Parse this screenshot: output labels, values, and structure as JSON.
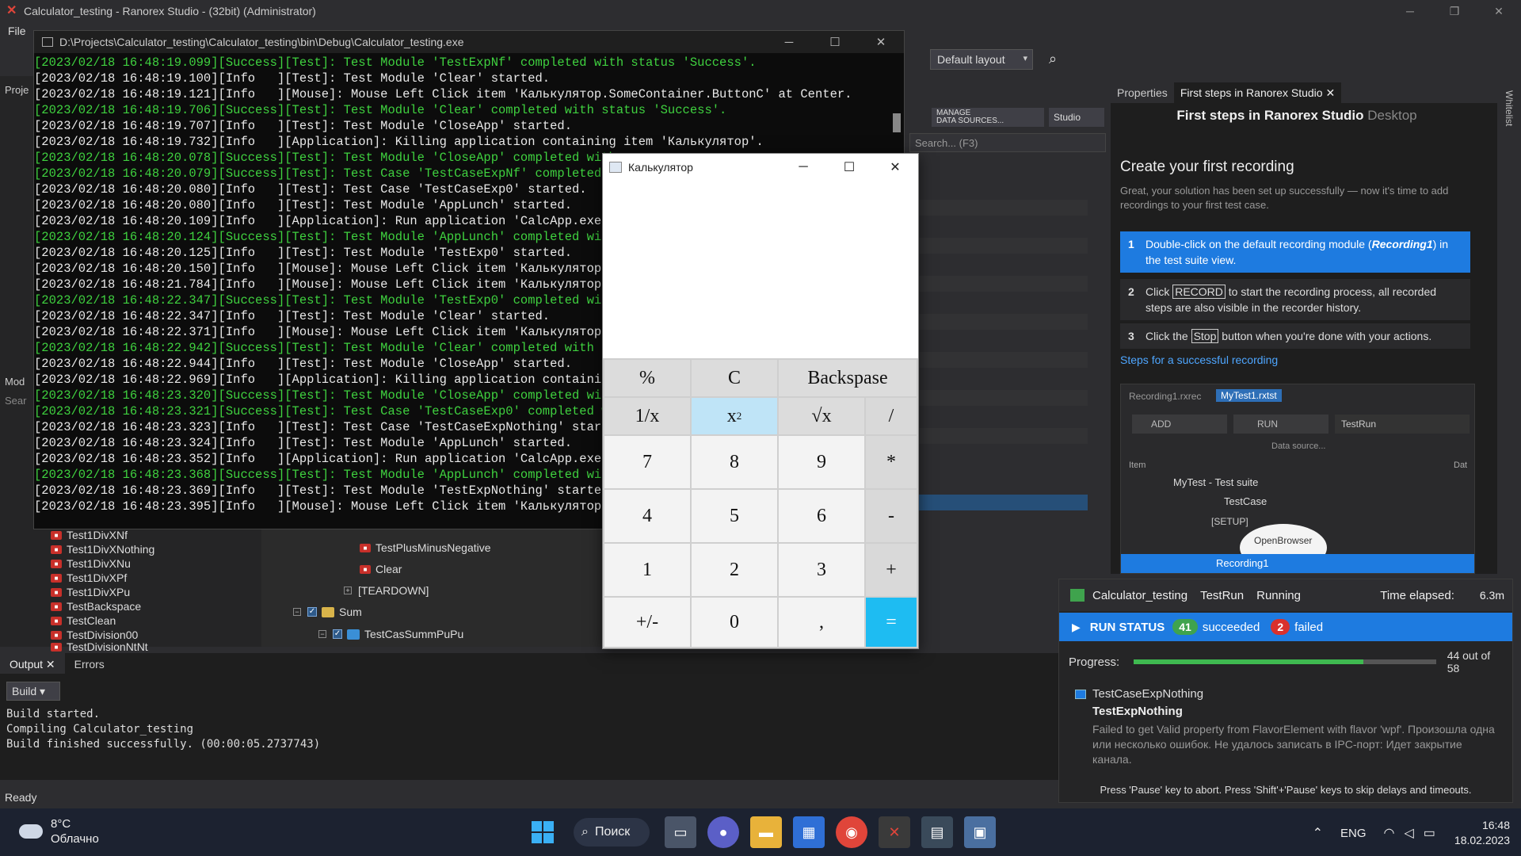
{
  "app": {
    "title": "Calculator_testing - Ranorex Studio - (32bit) (Administrator)",
    "menu_file": "File",
    "layout_select": "Default layout",
    "status": "Ready"
  },
  "center_toolbar": {
    "manage_ds_line1": "MANAGE",
    "manage_ds_line2": "DATA SOURCES...",
    "studio": "Studio",
    "search_placeholder": "Search... (F3)"
  },
  "left_panel": {
    "projects_tab": "Proje",
    "modules_tab": "Mod",
    "search": "Sear",
    "modules": [
      "Test1DivXNf",
      "Test1DivXNothing",
      "Test1DivXNu",
      "Test1DivXPf",
      "Test1DivXPu",
      "TestBackspace",
      "TestClean",
      "TestDivision00",
      "TestDivisionNtNt"
    ]
  },
  "tree": {
    "test_plus_minus_negative": "TestPlusMinusNegative",
    "clear": "Clear",
    "teardown": "[TEARDOWN]",
    "sum": "Sum",
    "test_case_summ": "TestCasSummPuPu"
  },
  "console": {
    "title": "D:\\Projects\\Calculator_testing\\Calculator_testing\\bin\\Debug\\Calculator_testing.exe",
    "lines": [
      {
        "type": "success",
        "text": "[2023/02/18 16:48:19.099][Success][Test]: Test Module 'TestExpNf' completed with status 'Success'."
      },
      {
        "type": "info",
        "text": "[2023/02/18 16:48:19.100][Info   ][Test]: Test Module 'Clear' started."
      },
      {
        "type": "info",
        "text": "[2023/02/18 16:48:19.121][Info   ][Mouse]: Mouse Left Click item 'Калькулятор.SomeContainer.ButtonC' at Center."
      },
      {
        "type": "success",
        "text": "[2023/02/18 16:48:19.706][Success][Test]: Test Module 'Clear' completed with status 'Success'."
      },
      {
        "type": "info",
        "text": "[2023/02/18 16:48:19.707][Info   ][Test]: Test Module 'CloseApp' started."
      },
      {
        "type": "info",
        "text": "[2023/02/18 16:48:19.732][Info   ][Application]: Killing application containing item 'Калькулятор'."
      },
      {
        "type": "success",
        "text": "[2023/02/18 16:48:20.078][Success][Test]: Test Module 'CloseApp' completed with"
      },
      {
        "type": "success",
        "text": "[2023/02/18 16:48:20.079][Success][Test]: Test Case 'TestCaseExpNf' completed wi"
      },
      {
        "type": "info",
        "text": "[2023/02/18 16:48:20.080][Info   ][Test]: Test Case 'TestCaseExp0' started."
      },
      {
        "type": "info",
        "text": "[2023/02/18 16:48:20.080][Info   ][Test]: Test Module 'AppLunch' started."
      },
      {
        "type": "info",
        "text": "[2023/02/18 16:48:20.109][Info   ][Application]: Run application 'CalcApp.exe' i"
      },
      {
        "type": "success",
        "text": "[2023/02/18 16:48:20.124][Success][Test]: Test Module 'AppLunch' completed with"
      },
      {
        "type": "info",
        "text": "[2023/02/18 16:48:20.125][Info   ][Test]: Test Module 'TestExp0' started."
      },
      {
        "type": "info",
        "text": "[2023/02/18 16:48:20.150][Info   ][Mouse]: Mouse Left Click item 'Калькулятор.So"
      },
      {
        "type": "info",
        "text": "[2023/02/18 16:48:21.784][Info   ][Mouse]: Mouse Left Click item 'Калькулятор.So"
      },
      {
        "type": "success",
        "text": "[2023/02/18 16:48:22.347][Success][Test]: Test Module 'TestExp0' completed with"
      },
      {
        "type": "info",
        "text": "[2023/02/18 16:48:22.347][Info   ][Test]: Test Module 'Clear' started."
      },
      {
        "type": "info",
        "text": "[2023/02/18 16:48:22.371][Info   ][Mouse]: Mouse Left Click item 'Калькулятор.So"
      },
      {
        "type": "success",
        "text": "[2023/02/18 16:48:22.942][Success][Test]: Test Module 'Clear' completed with st"
      },
      {
        "type": "info",
        "text": "[2023/02/18 16:48:22.944][Info   ][Test]: Test Module 'CloseApp' started."
      },
      {
        "type": "info",
        "text": "[2023/02/18 16:48:22.969][Info   ][Application]: Killing application containing"
      },
      {
        "type": "success",
        "text": "[2023/02/18 16:48:23.320][Success][Test]: Test Module 'CloseApp' completed with"
      },
      {
        "type": "success",
        "text": "[2023/02/18 16:48:23.321][Success][Test]: Test Case 'TestCaseExp0' completed wi"
      },
      {
        "type": "info",
        "text": "[2023/02/18 16:48:23.323][Info   ][Test]: Test Case 'TestCaseExpNothing' started"
      },
      {
        "type": "info",
        "text": "[2023/02/18 16:48:23.324][Info   ][Test]: Test Module 'AppLunch' started."
      },
      {
        "type": "info",
        "text": "[2023/02/18 16:48:23.352][Info   ][Application]: Run application 'CalcApp.exe' i"
      },
      {
        "type": "success",
        "text": "[2023/02/18 16:48:23.368][Success][Test]: Test Module 'AppLunch' completed with"
      },
      {
        "type": "info",
        "text": "[2023/02/18 16:48:23.369][Info   ][Test]: Test Module 'TestExpNothing' started."
      },
      {
        "type": "info",
        "text": "[2023/02/18 16:48:23.395][Info   ][Mouse]: Mouse Left Click item 'Калькулятор.So"
      }
    ]
  },
  "calculator": {
    "title": "Калькулятор",
    "display": "",
    "keys": {
      "percent": "%",
      "clear": "C",
      "backspace": "Backspase",
      "reciprocal": "1/x",
      "square": "x",
      "square_sup": "2",
      "sqrt": "√x",
      "divide": "/",
      "seven": "7",
      "eight": "8",
      "nine": "9",
      "multiply": "*",
      "four": "4",
      "five": "5",
      "six": "6",
      "minus": "-",
      "one": "1",
      "two": "2",
      "three": "3",
      "plus": "+",
      "negate": "+/-",
      "zero": "0",
      "comma": ",",
      "equals": "="
    }
  },
  "right_panel": {
    "tab_properties": "Properties",
    "tab_first_steps": "First steps in Ranorex Studio",
    "title": "First steps in Ranorex Studio",
    "title_sub": "Desktop",
    "heading": "Create your first recording",
    "intro": "Great, your solution has been set up successfully — now it's time to add recordings to your first test case.",
    "steps": [
      {
        "n": "1",
        "pre": "Double-click on the default recording module (",
        "em": "Recording1",
        "post": ") in the test suite view."
      },
      {
        "n": "2",
        "pre": "Click ",
        "kbd": "RECORD",
        "post": " to start the recording process, all recorded steps are also visible in the recorder history."
      },
      {
        "n": "3",
        "pre": "Click the ",
        "kbd": "Stop",
        "post": " button when you're done with your actions."
      }
    ],
    "link": "Steps for a successful recording",
    "preview": {
      "tab1": "Recording1.rxrec",
      "tab2": "MyTest1.rxtst",
      "add": "ADD",
      "run": "RUN",
      "testrun": "TestRun",
      "data_source": "Data source...",
      "col_item": "Item",
      "col_dat": "Dat",
      "suite": "MyTest - Test suite",
      "testcase": "TestCase",
      "setup": "[SETUP]",
      "open_browser": "OpenBrowser",
      "recording1": "Recording1"
    }
  },
  "run": {
    "solution": "Calculator_testing",
    "testrun": "TestRun",
    "state": "Running",
    "elapsed_label": "Time elapsed:",
    "elapsed_value": "6.3m",
    "status_label": "RUN STATUS",
    "succeeded_count": "41",
    "succeeded_label": "succeeded",
    "failed_count": "2",
    "failed_label": "failed",
    "progress_label": "Progress:",
    "progress_fraction": 0.759,
    "progress_text": "44 out of 58",
    "test_case": "TestCaseExpNothing",
    "test_module": "TestExpNothing",
    "error": "Failed to get Valid property from FlavorElement with flavor 'wpf'. Произошла одна или несколько ошибок. Не удалось записать в IPC-порт: Идет закрытие канала.",
    "footer": "Press 'Pause' key to abort. Press 'Shift'+'Pause' keys to skip delays and timeouts."
  },
  "output": {
    "tab_output": "Output",
    "tab_errors": "Errors",
    "build_select": "Build",
    "lines": [
      "Build started.",
      "Compiling Calculator_testing",
      "Build finished successfully. (00:00:05.2737743)"
    ]
  },
  "edge": {
    "whitelist": "Whitelist"
  },
  "taskbar": {
    "temp": "8°C",
    "weather": "Облачно",
    "search": "Поиск",
    "lang": "ENG",
    "time": "16:48",
    "date": "18.02.2023"
  }
}
